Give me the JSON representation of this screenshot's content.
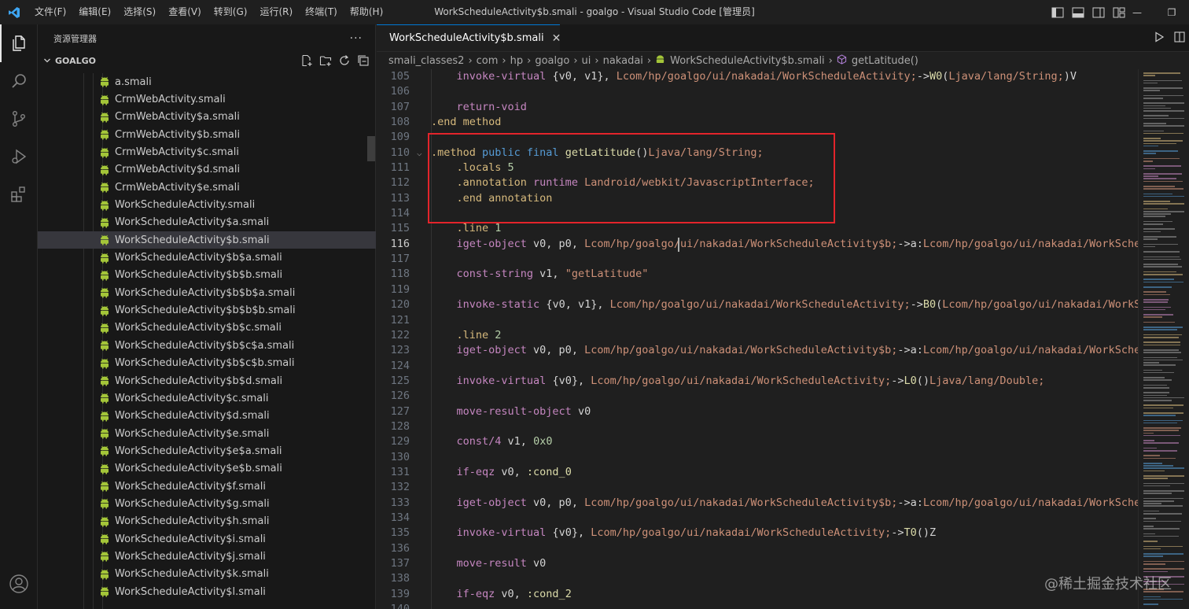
{
  "titlebar": {
    "menu": [
      "文件(F)",
      "编辑(E)",
      "选择(S)",
      "查看(V)",
      "转到(G)",
      "运行(R)",
      "终端(T)",
      "帮助(H)"
    ],
    "title": "WorkScheduleActivity$b.smali - goalgo - Visual Studio Code [管理员]"
  },
  "sidebar": {
    "title": "资源管理器",
    "more": "···",
    "section": "GOALGO",
    "files": [
      "a.smali",
      "CrmWebActivity.smali",
      "CrmWebActivity$a.smali",
      "CrmWebActivity$b.smali",
      "CrmWebActivity$c.smali",
      "CrmWebActivity$d.smali",
      "CrmWebActivity$e.smali",
      "WorkScheduleActivity.smali",
      "WorkScheduleActivity$a.smali",
      "WorkScheduleActivity$b.smali",
      "WorkScheduleActivity$b$a.smali",
      "WorkScheduleActivity$b$b.smali",
      "WorkScheduleActivity$b$b$a.smali",
      "WorkScheduleActivity$b$b$b.smali",
      "WorkScheduleActivity$b$c.smali",
      "WorkScheduleActivity$b$c$a.smali",
      "WorkScheduleActivity$b$c$b.smali",
      "WorkScheduleActivity$b$d.smali",
      "WorkScheduleActivity$c.smali",
      "WorkScheduleActivity$d.smali",
      "WorkScheduleActivity$e.smali",
      "WorkScheduleActivity$e$a.smali",
      "WorkScheduleActivity$e$b.smali",
      "WorkScheduleActivity$f.smali",
      "WorkScheduleActivity$g.smali",
      "WorkScheduleActivity$h.smali",
      "WorkScheduleActivity$i.smali",
      "WorkScheduleActivity$j.smali",
      "WorkScheduleActivity$k.smali",
      "WorkScheduleActivity$l.smali"
    ],
    "selected_file": "WorkScheduleActivity$b.smali"
  },
  "editor": {
    "tab_label": "WorkScheduleActivity$b.smali",
    "tab_close": "✕",
    "breadcrumb": [
      "smali_classes2",
      "com",
      "hp",
      "goalgo",
      "ui",
      "nakadai",
      "WorkScheduleActivity$b.smali",
      "getLatitude()"
    ],
    "current_line": 116,
    "lines": [
      {
        "n": 105,
        "t": [
          [
            "t-p",
            "    invoke-virtual "
          ],
          [
            "t-w",
            "{v0, v1}, "
          ],
          [
            "t-c",
            "Lcom/hp/goalgo/ui/nakadai/WorkScheduleActivity;"
          ],
          [
            "t-w",
            "->"
          ],
          [
            "t-m",
            "W0"
          ],
          [
            "t-w",
            "("
          ],
          [
            "t-c",
            "Ljava/lang/String;"
          ],
          [
            "t-w",
            ")V"
          ]
        ]
      },
      {
        "n": 106,
        "t": []
      },
      {
        "n": 107,
        "t": [
          [
            "t-p",
            "    return-void"
          ]
        ]
      },
      {
        "n": 108,
        "t": [
          [
            "t-d",
            ".end method"
          ]
        ]
      },
      {
        "n": 109,
        "t": []
      },
      {
        "n": 110,
        "fold": true,
        "t": [
          [
            "t-d",
            ".method "
          ],
          [
            "t-k",
            "public final "
          ],
          [
            "t-m",
            "getLatitude"
          ],
          [
            "t-w",
            "()"
          ],
          [
            "t-c",
            "Ljava/lang/String;"
          ]
        ]
      },
      {
        "n": 111,
        "t": [
          [
            "t-d",
            "    .locals "
          ],
          [
            "t-n",
            "5"
          ]
        ]
      },
      {
        "n": 112,
        "t": [
          [
            "t-d",
            "    .annotation "
          ],
          [
            "t-p",
            "runtime "
          ],
          [
            "t-c",
            "Landroid/webkit/JavascriptInterface;"
          ]
        ]
      },
      {
        "n": 113,
        "t": [
          [
            "t-d",
            "    .end annotation"
          ]
        ]
      },
      {
        "n": 114,
        "t": []
      },
      {
        "n": 115,
        "t": [
          [
            "t-d",
            "    .line "
          ],
          [
            "t-n",
            "1"
          ]
        ]
      },
      {
        "n": 116,
        "t": [
          [
            "t-p",
            "    iget-object "
          ],
          [
            "t-w",
            "v0, p0, "
          ],
          [
            "t-c",
            "Lcom/hp/goalgo/ui/nakadai/WorkScheduleActivity$b;"
          ],
          [
            "t-w",
            "->a:"
          ],
          [
            "t-c",
            "Lcom/hp/goalgo/ui/nakadai/WorkScheduleA"
          ]
        ]
      },
      {
        "n": 117,
        "t": []
      },
      {
        "n": 118,
        "t": [
          [
            "t-p",
            "    const-string "
          ],
          [
            "t-w",
            "v1, "
          ],
          [
            "t-c",
            "\"getLatitude\""
          ]
        ]
      },
      {
        "n": 119,
        "t": []
      },
      {
        "n": 120,
        "t": [
          [
            "t-p",
            "    invoke-static "
          ],
          [
            "t-w",
            "{v0, v1}, "
          ],
          [
            "t-c",
            "Lcom/hp/goalgo/ui/nakadai/WorkScheduleActivity;"
          ],
          [
            "t-w",
            "->"
          ],
          [
            "t-m",
            "B0"
          ],
          [
            "t-w",
            "("
          ],
          [
            "t-c",
            "Lcom/hp/goalgo/ui/nakadai/WorkSche"
          ]
        ]
      },
      {
        "n": 121,
        "t": []
      },
      {
        "n": 122,
        "t": [
          [
            "t-d",
            "    .line "
          ],
          [
            "t-n",
            "2"
          ]
        ]
      },
      {
        "n": 123,
        "t": [
          [
            "t-p",
            "    iget-object "
          ],
          [
            "t-w",
            "v0, p0, "
          ],
          [
            "t-c",
            "Lcom/hp/goalgo/ui/nakadai/WorkScheduleActivity$b;"
          ],
          [
            "t-w",
            "->a:"
          ],
          [
            "t-c",
            "Lcom/hp/goalgo/ui/nakadai/WorkScheduleA"
          ]
        ]
      },
      {
        "n": 124,
        "t": []
      },
      {
        "n": 125,
        "t": [
          [
            "t-p",
            "    invoke-virtual "
          ],
          [
            "t-w",
            "{v0}, "
          ],
          [
            "t-c",
            "Lcom/hp/goalgo/ui/nakadai/WorkScheduleActivity;"
          ],
          [
            "t-w",
            "->"
          ],
          [
            "t-m",
            "L0"
          ],
          [
            "t-w",
            "()"
          ],
          [
            "t-c",
            "Ljava/lang/Double;"
          ]
        ]
      },
      {
        "n": 126,
        "t": []
      },
      {
        "n": 127,
        "t": [
          [
            "t-p",
            "    move-result-object "
          ],
          [
            "t-w",
            "v0"
          ]
        ]
      },
      {
        "n": 128,
        "t": []
      },
      {
        "n": 129,
        "t": [
          [
            "t-p",
            "    const/4 "
          ],
          [
            "t-w",
            "v1, "
          ],
          [
            "t-n",
            "0x0"
          ]
        ]
      },
      {
        "n": 130,
        "t": []
      },
      {
        "n": 131,
        "t": [
          [
            "t-p",
            "    if-eqz "
          ],
          [
            "t-w",
            "v0, "
          ],
          [
            "t-m",
            ":cond_0"
          ]
        ]
      },
      {
        "n": 132,
        "t": []
      },
      {
        "n": 133,
        "t": [
          [
            "t-p",
            "    iget-object "
          ],
          [
            "t-w",
            "v0, p0, "
          ],
          [
            "t-c",
            "Lcom/hp/goalgo/ui/nakadai/WorkScheduleActivity$b;"
          ],
          [
            "t-w",
            "->a:"
          ],
          [
            "t-c",
            "Lcom/hp/goalgo/ui/nakadai/WorkScheduleA"
          ]
        ]
      },
      {
        "n": 134,
        "t": []
      },
      {
        "n": 135,
        "t": [
          [
            "t-p",
            "    invoke-virtual "
          ],
          [
            "t-w",
            "{v0}, "
          ],
          [
            "t-c",
            "Lcom/hp/goalgo/ui/nakadai/WorkScheduleActivity;"
          ],
          [
            "t-w",
            "->"
          ],
          [
            "t-m",
            "T0"
          ],
          [
            "t-w",
            "()Z"
          ]
        ]
      },
      {
        "n": 136,
        "t": []
      },
      {
        "n": 137,
        "t": [
          [
            "t-p",
            "    move-result "
          ],
          [
            "t-w",
            "v0"
          ]
        ]
      },
      {
        "n": 138,
        "t": []
      },
      {
        "n": 139,
        "t": [
          [
            "t-p",
            "    if-eqz "
          ],
          [
            "t-w",
            "v0, "
          ],
          [
            "t-m",
            ":cond_2"
          ]
        ]
      },
      {
        "n": 140,
        "t": []
      }
    ]
  },
  "watermark": "@稀土掘金技术社区",
  "colors": {
    "accent": "#0078d4",
    "highlight_box": "#e3242b",
    "android": "#a4c639"
  },
  "icons": {
    "activitybar": [
      "files-icon",
      "search-icon",
      "source-control-icon",
      "run-debug-icon",
      "extensions-icon"
    ],
    "account": "account-icon"
  }
}
